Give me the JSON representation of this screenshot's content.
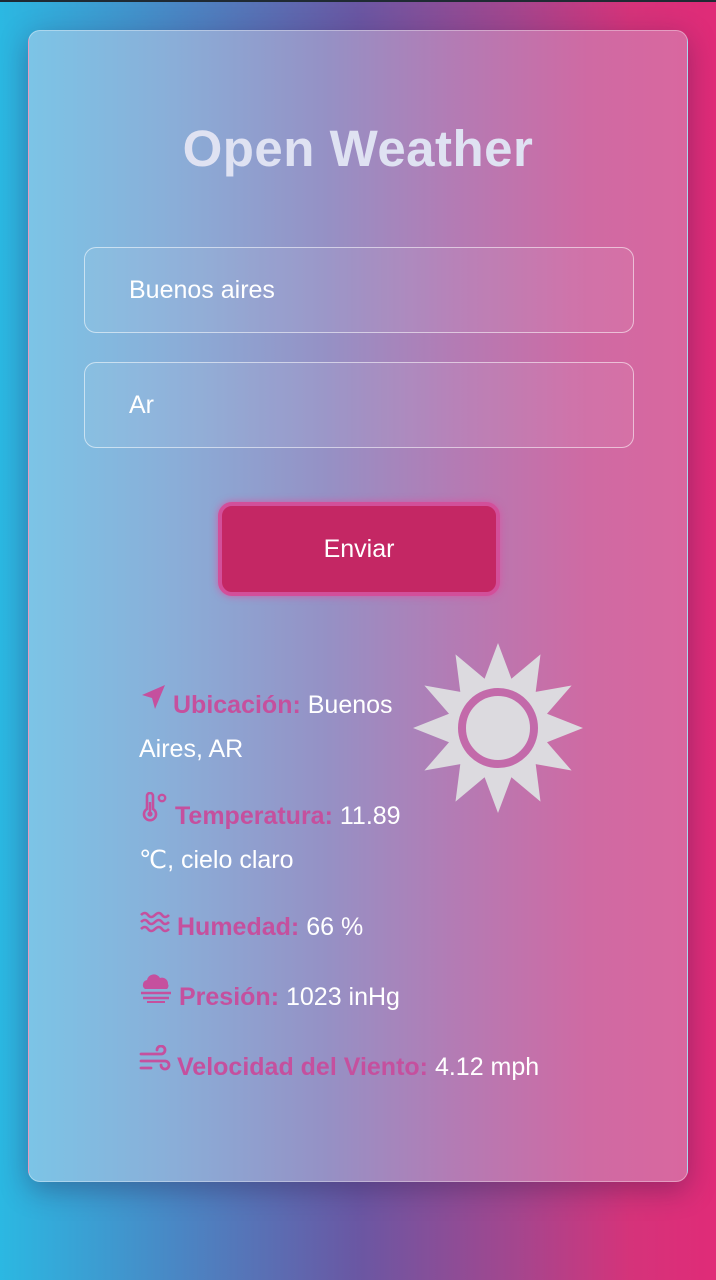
{
  "app": {
    "title": "Open Weather"
  },
  "form": {
    "city_value": "Buenos aires",
    "country_value": "Ar",
    "submit_label": "Enviar"
  },
  "weather": {
    "location_label": "Ubicación:",
    "location_value": "Buenos Aires, AR",
    "temperature_label": "Temperatura:",
    "temperature_value": "11.89 ℃, cielo claro",
    "humidity_label": "Humedad:",
    "humidity_value": "66 %",
    "pressure_label": "Presión:",
    "pressure_value": "1023 inHg",
    "wind_label": "Velocidad del Viento:",
    "wind_value": "4.12 mph",
    "condition_icon": "sun-icon"
  },
  "colors": {
    "label_accent": "#c5509e",
    "button": "#c42764",
    "title": "#dfe2f2"
  }
}
